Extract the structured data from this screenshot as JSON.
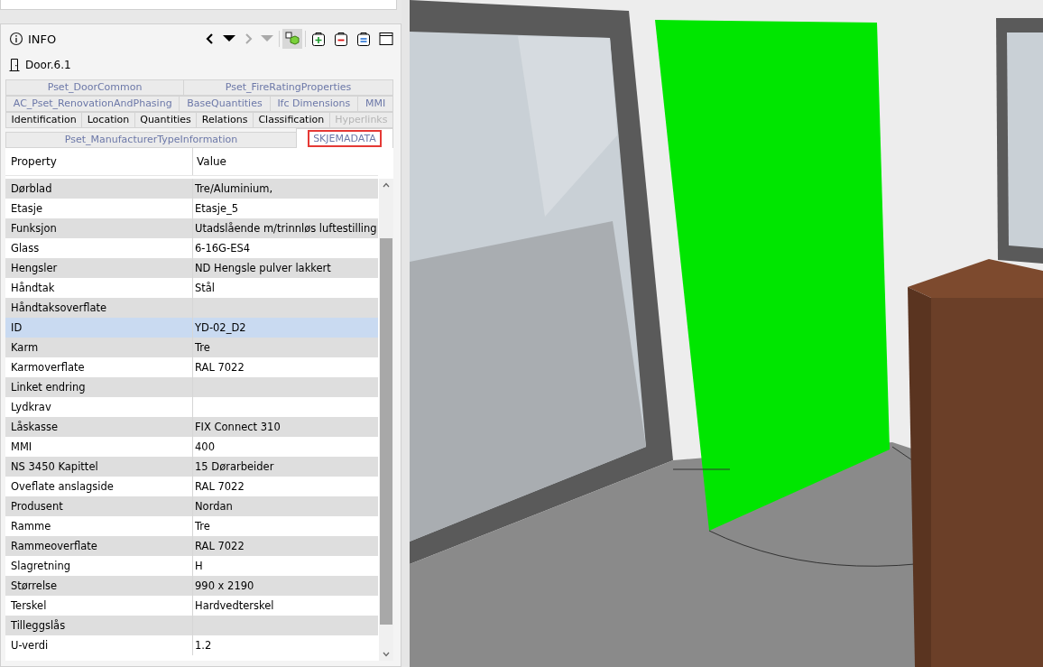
{
  "info": {
    "title": "INFO",
    "object_name": "Door.6.1",
    "toolbar": {
      "back_disabled": false,
      "forward_disabled": true,
      "isolate_on": true
    }
  },
  "tab_rows": [
    [
      {
        "label": "Pset_DoorCommon",
        "kind": "pset",
        "selected": false,
        "disabled": false,
        "outlined": false
      },
      {
        "label": "Pset_FireRatingProperties",
        "kind": "pset",
        "selected": false,
        "disabled": false,
        "outlined": false
      }
    ],
    [
      {
        "label": "AC_Pset_RenovationAndPhasing",
        "kind": "pset",
        "selected": false,
        "disabled": false,
        "outlined": false
      },
      {
        "label": "BaseQuantities",
        "kind": "pset",
        "selected": false,
        "disabled": false,
        "outlined": false
      },
      {
        "label": "Ifc Dimensions",
        "kind": "pset",
        "selected": false,
        "disabled": false,
        "outlined": false
      },
      {
        "label": "MMI",
        "kind": "pset",
        "selected": false,
        "disabled": false,
        "outlined": false
      }
    ],
    [
      {
        "label": "Identification",
        "kind": "main",
        "selected": false,
        "disabled": false,
        "outlined": false
      },
      {
        "label": "Location",
        "kind": "main",
        "selected": false,
        "disabled": false,
        "outlined": false
      },
      {
        "label": "Quantities",
        "kind": "main",
        "selected": false,
        "disabled": false,
        "outlined": false
      },
      {
        "label": "Relations",
        "kind": "main",
        "selected": false,
        "disabled": false,
        "outlined": false
      },
      {
        "label": "Classification",
        "kind": "main",
        "selected": false,
        "disabled": false,
        "outlined": false
      },
      {
        "label": "Hyperlinks",
        "kind": "main",
        "selected": false,
        "disabled": true,
        "outlined": false
      }
    ],
    [
      {
        "label": "Pset_ManufacturerTypeInformation",
        "kind": "pset",
        "selected": false,
        "disabled": false,
        "outlined": false
      },
      {
        "label": "SKJEMADATA",
        "kind": "pset",
        "selected": true,
        "disabled": false,
        "outlined": true
      }
    ]
  ],
  "table": {
    "columns": [
      "Property",
      "Value"
    ],
    "rows": [
      {
        "property": "Dørblad",
        "value": "Tre/Aluminium,",
        "selected": false
      },
      {
        "property": "Etasje",
        "value": "Etasje_5",
        "selected": false
      },
      {
        "property": "Funksjon",
        "value": "Utadslående m/trinnløs luftestilling",
        "selected": false
      },
      {
        "property": "Glass",
        "value": "6-16G-ES4",
        "selected": false
      },
      {
        "property": "Hengsler",
        "value": "ND Hengsle pulver lakkert",
        "selected": false
      },
      {
        "property": "Håndtak",
        "value": "Stål",
        "selected": false
      },
      {
        "property": "Håndtaksoverflate",
        "selected": false
      },
      {
        "property": "ID",
        "value": "YD-02_D2",
        "selected": true
      },
      {
        "property": "Karm",
        "value": "Tre",
        "selected": false
      },
      {
        "property": "Karmoverflate",
        "value": "RAL 7022",
        "selected": false
      },
      {
        "property": "Linket endring",
        "selected": false
      },
      {
        "property": "Lydkrav",
        "selected": false
      },
      {
        "property": "Låskasse",
        "value": "FIX Connect 310",
        "selected": false
      },
      {
        "property": "MMI",
        "value": "400",
        "selected": false
      },
      {
        "property": "NS 3450 Kapittel",
        "value": "15 Dørarbeider",
        "selected": false
      },
      {
        "property": "Oveflate anslagside",
        "value": "RAL 7022",
        "selected": false
      },
      {
        "property": "Produsent",
        "value": "Nordan",
        "selected": false
      },
      {
        "property": "Ramme",
        "value": "Tre",
        "selected": false
      },
      {
        "property": "Rammeoverflate",
        "value": "RAL 7022",
        "selected": false
      },
      {
        "property": "Slagretning",
        "value": "H",
        "selected": false
      },
      {
        "property": "Størrelse",
        "value": "990 x 2190",
        "selected": false
      },
      {
        "property": "Terskel",
        "value": "Hardvedterskel",
        "selected": false
      },
      {
        "property": "Tilleggslås",
        "selected": false
      },
      {
        "property": "U-verdi",
        "value": "1.2",
        "selected": false
      }
    ]
  }
}
